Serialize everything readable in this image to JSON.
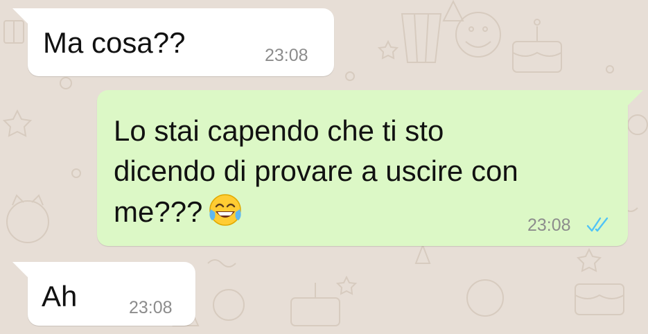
{
  "messages": [
    {
      "direction": "incoming",
      "text": "Ma cosa??",
      "time": "23:08"
    },
    {
      "direction": "outgoing",
      "lines": [
        "Lo stai capendo che ti sto",
        "dicendo di provare a uscire con",
        "me???"
      ],
      "emoji": "face-with-tears-of-joy",
      "time": "23:08",
      "status": "read-double-tick"
    },
    {
      "direction": "incoming",
      "text": "Ah",
      "time": "23:08"
    }
  ],
  "colors": {
    "chat_background": "#e7ded6",
    "incoming_bubble": "#ffffff",
    "outgoing_bubble": "#dcf8c6",
    "timestamp": "#8c8c8c",
    "read_ticks": "#4fc3f7"
  },
  "icons": [
    "doodle-wallpaper",
    "face-with-tears-of-joy-emoji",
    "double-check-icon"
  ]
}
